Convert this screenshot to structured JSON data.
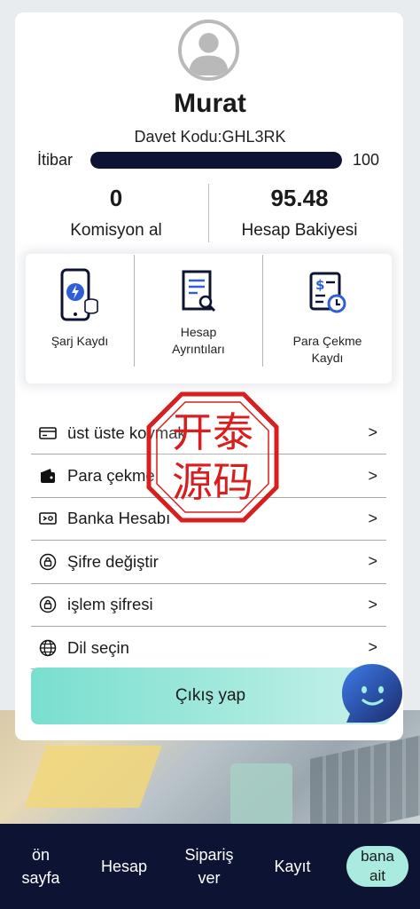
{
  "profile": {
    "username": "Murat",
    "invite_code": "Davet Kodu:GHL3RK",
    "reputation_label": "İtibar",
    "reputation_value": "100",
    "reputation_fraction": 1.0
  },
  "stats": {
    "commission_value": "0",
    "commission_label": "Komisyon al",
    "balance_value": "95.48",
    "balance_label": "Hesap Bakiyesi"
  },
  "quick_actions": [
    {
      "label": "Şarj Kaydı",
      "icon": "phone-charge-icon"
    },
    {
      "label_line1": "Hesap",
      "label_line2": "Ayrıntıları",
      "icon": "document-search-icon"
    },
    {
      "label_line1": "Para Çekme",
      "label_line2": "Kaydı",
      "icon": "dollar-clock-icon"
    }
  ],
  "menu": [
    {
      "label": "üst üste koymak",
      "icon": "card-icon"
    },
    {
      "label": "Para çekme",
      "icon": "wallet-icon"
    },
    {
      "label": "Banka Hesabı",
      "icon": "bank-card-icon"
    },
    {
      "label": "Şifre değiştir",
      "icon": "lock-icon"
    },
    {
      "label": "işlem şifresi",
      "icon": "lock-icon"
    },
    {
      "label": "Dil seçin",
      "icon": "globe-icon"
    }
  ],
  "menu_arrow": ">",
  "logout_label": "Çıkış yap",
  "seal": {
    "line1": "开泰",
    "line2": "源码",
    "color": "#d81e1e"
  },
  "nav": [
    {
      "line1": "ön",
      "line2": "sayfa"
    },
    {
      "label": "Hesap"
    },
    {
      "line1": "Sipariş",
      "line2": "ver"
    },
    {
      "label": "Kayıt"
    },
    {
      "line1": "bana",
      "line2": "ait",
      "active": true
    }
  ],
  "colors": {
    "navy": "#0d1433",
    "accent": "#a9ecdf",
    "seal": "#d81e1e"
  }
}
